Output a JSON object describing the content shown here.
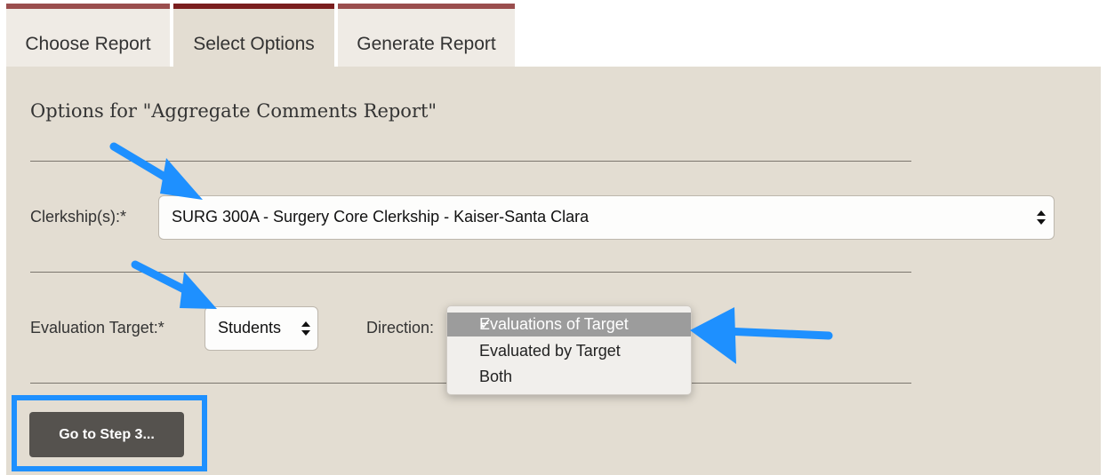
{
  "tabs": [
    {
      "label": "Choose Report"
    },
    {
      "label": "Select Options",
      "active": true
    },
    {
      "label": "Generate Report"
    }
  ],
  "options": {
    "title": "Options for \"Aggregate Comments Report\"",
    "clerkship": {
      "label": "Clerkship(s):*",
      "value": "SURG 300A - Surgery Core Clerkship - Kaiser-Santa Clara"
    },
    "target": {
      "label": "Evaluation Target:*",
      "value": "Students"
    },
    "direction": {
      "label": "Direction:",
      "options": [
        "Evaluations of Target",
        "Evaluated by Target",
        "Both"
      ],
      "selected": "Evaluations of Target"
    },
    "submit_label": "Go to Step 3..."
  },
  "colors": {
    "panel_bg": "#e3ddd2",
    "tab_accent": "#7a1e1e",
    "button_bg": "#55524e",
    "annotation": "#1e90ff"
  }
}
